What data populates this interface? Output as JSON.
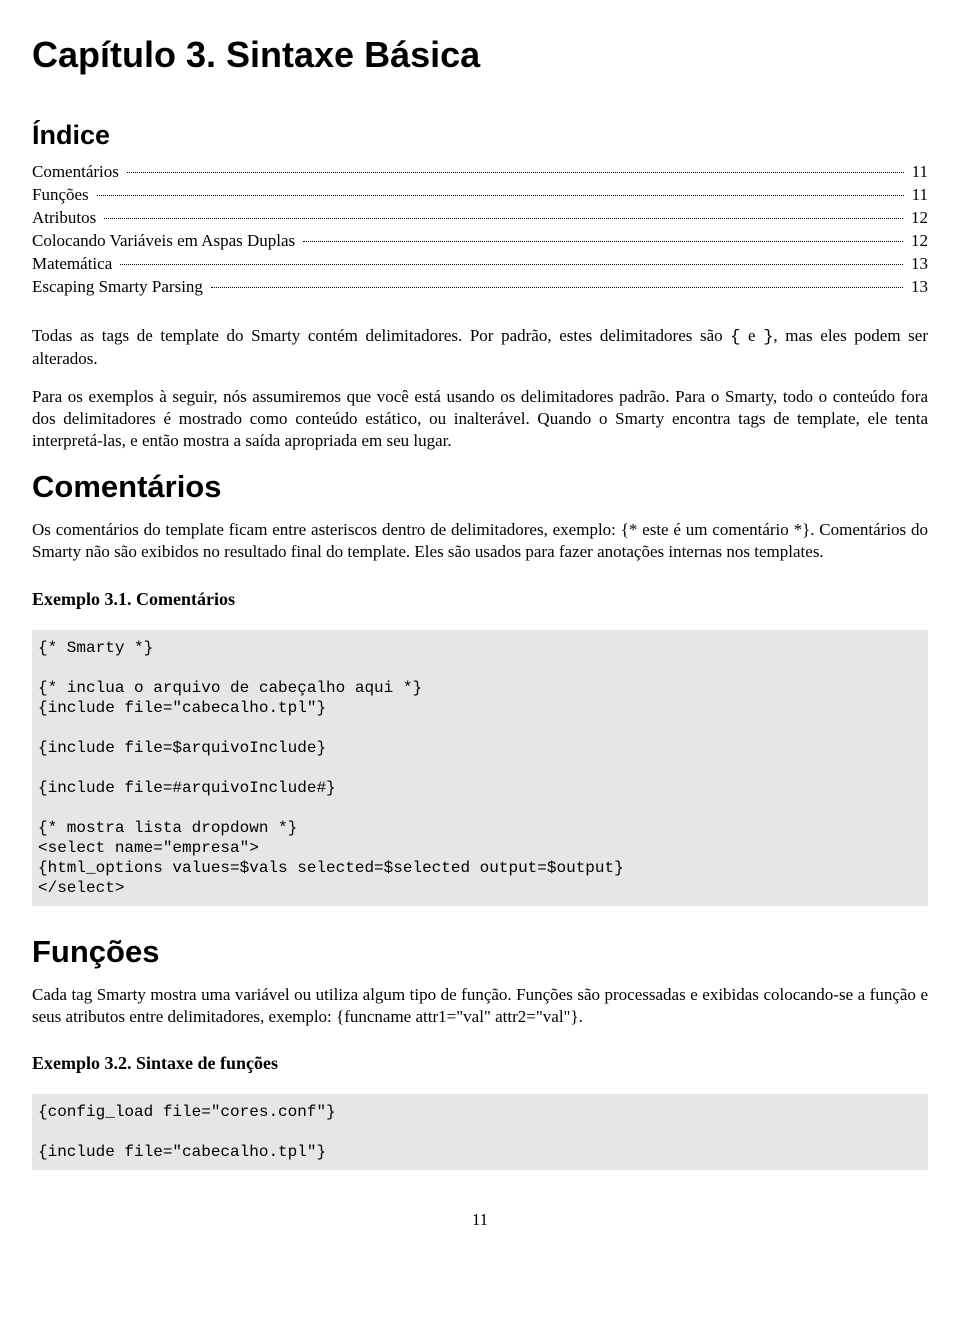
{
  "chapter_title": "Capítulo 3. Sintaxe Básica",
  "toc": {
    "heading": "Índice",
    "items": [
      {
        "label": "Comentários",
        "page": "11"
      },
      {
        "label": "Funções",
        "page": "11"
      },
      {
        "label": "Atributos",
        "page": "12"
      },
      {
        "label": "Colocando Variáveis em Aspas Duplas",
        "page": "12"
      },
      {
        "label": "Matemática",
        "page": "13"
      },
      {
        "label": "Escaping Smarty Parsing",
        "page": "13"
      }
    ]
  },
  "intro_p1_a": "Todas as tags de template do Smarty contém delimitadores. Por padrão, estes delimitadores são ",
  "intro_p1_b": "{",
  "intro_p1_c": " e ",
  "intro_p1_d": "}",
  "intro_p1_e": ", mas eles podem ser alterados.",
  "intro_p2": "Para os exemplos à seguir, nós assumiremos que você está usando os delimitadores padrão. Para o Smarty, todo o conteúdo fora dos delimitadores é mostrado como conteúdo estático, ou inalterável. Quando o Smarty encontra tags de template, ele tenta interpretá-las, e então mostra a saída apropriada em seu lugar.",
  "comentarios": {
    "heading": "Comentários",
    "body": "Os comentários do template ficam entre asteriscos dentro de delimitadores, exemplo: {* este é um comentário *}. Comentários do Smarty não são exibidos no resultado final do template. Eles são usados para fazer anotações internas nos templates.",
    "example_title": "Exemplo 3.1. Comentários",
    "code": "{* Smarty *}\n\n{* inclua o arquivo de cabeçalho aqui *}\n{include file=\"cabecalho.tpl\"}\n\n{include file=$arquivoInclude}\n\n{include file=#arquivoInclude#}\n\n{* mostra lista dropdown *}\n<select name=\"empresa\">\n{html_options values=$vals selected=$selected output=$output}\n</select>"
  },
  "funcoes": {
    "heading": "Funções",
    "body": "Cada tag Smarty mostra uma variável ou utiliza algum tipo de função. Funções são processadas e exibidas colocando-se a função e seus atributos entre delimitadores, exemplo: {funcname attr1=\"val\" attr2=\"val\"}.",
    "example_title": "Exemplo 3.2. Sintaxe de funções",
    "code": "{config_load file=\"cores.conf\"}\n\n{include file=\"cabecalho.tpl\"}"
  },
  "page_number": "11"
}
